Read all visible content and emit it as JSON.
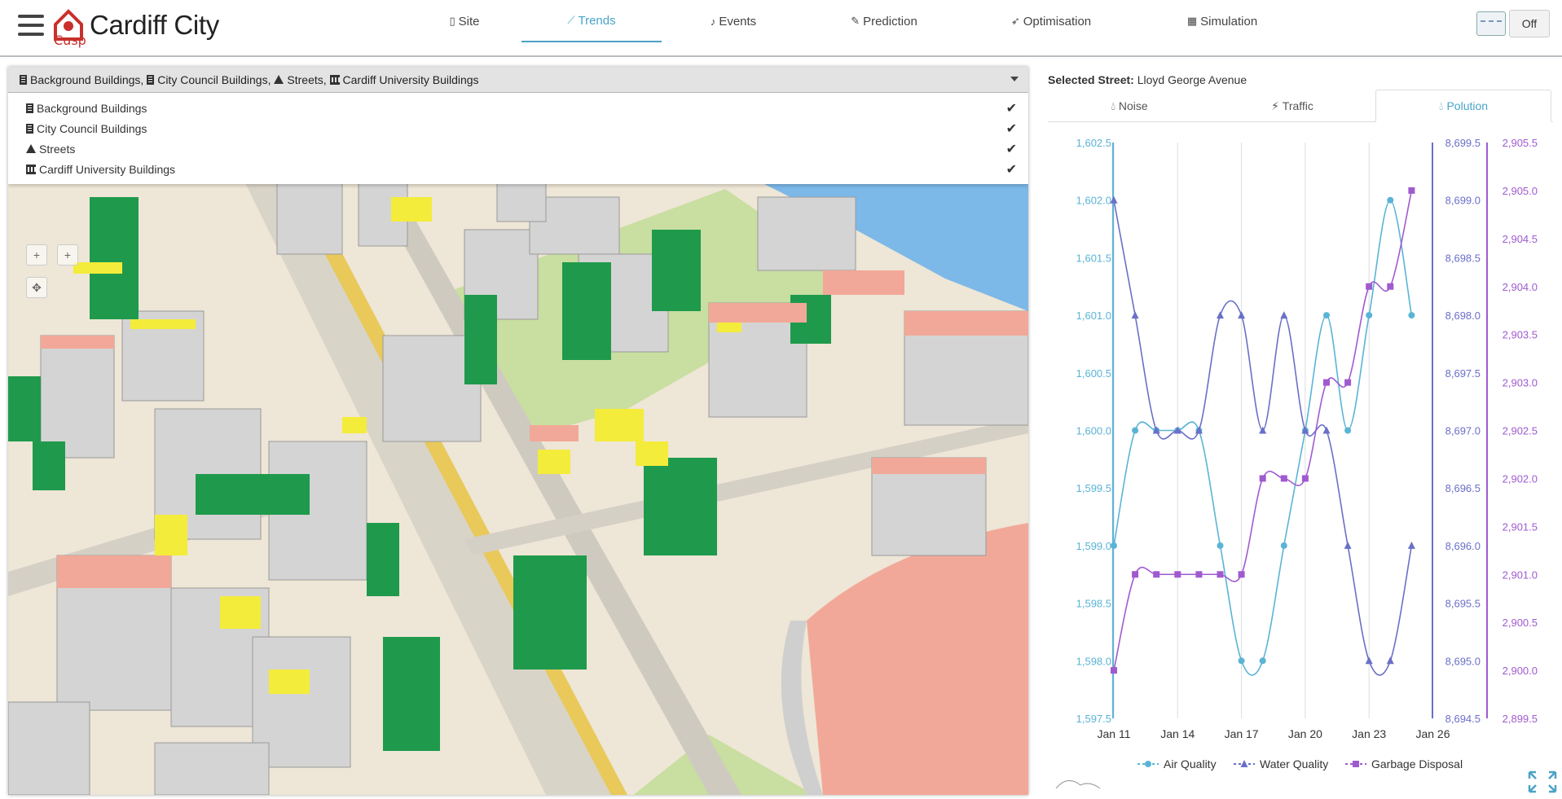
{
  "header": {
    "title": "Cardiff City",
    "logo_text": "Cusp",
    "nav": [
      {
        "label": "Site",
        "icon": "building-icon"
      },
      {
        "label": "Trends",
        "icon": "line-chart-icon",
        "active": true
      },
      {
        "label": "Events",
        "icon": "bell-icon"
      },
      {
        "label": "Prediction",
        "icon": "magic-icon"
      },
      {
        "label": "Optimisation",
        "icon": "rocket-icon"
      },
      {
        "label": "Simulation",
        "icon": "calculator-icon"
      }
    ],
    "toggle_label": "Off"
  },
  "layers": {
    "summary": "Background Buildings, City Council Buildings, Streets, Cardiff University Buildings",
    "summary_parts": [
      "Background Buildings,",
      "City Council Buildings,",
      "Streets,",
      "Cardiff University Buildings"
    ],
    "items": [
      {
        "label": "Background Buildings",
        "checked": true
      },
      {
        "label": "City Council Buildings",
        "checked": true
      },
      {
        "label": "Streets",
        "checked": true
      },
      {
        "label": "Cardiff University Buildings",
        "checked": true
      }
    ]
  },
  "map_controls": [
    "+",
    "+",
    "✥"
  ],
  "panel": {
    "selected_label": "Selected Street:",
    "selected_value": "Lloyd George Avenue",
    "tabs": [
      {
        "label": "Noise",
        "icon": "drop-icon"
      },
      {
        "label": "Traffic",
        "icon": "bolt-icon"
      },
      {
        "label": "Polution",
        "icon": "drop-icon",
        "active": true
      }
    ]
  },
  "chart_data": {
    "type": "line",
    "x": [
      "Jan 11",
      "Jan 12",
      "Jan 13",
      "Jan 14",
      "Jan 15",
      "Jan 16",
      "Jan 17",
      "Jan 18",
      "Jan 19",
      "Jan 20",
      "Jan 21",
      "Jan 22",
      "Jan 23",
      "Jan 24",
      "Jan 25"
    ],
    "xticks": [
      "Jan 11",
      "Jan 14",
      "Jan 17",
      "Jan 20",
      "Jan 23",
      "Jan 26"
    ],
    "series": [
      {
        "name": "Air Quality",
        "color": "#5ab4d6",
        "marker": "circle",
        "values": [
          1599.0,
          1600.0,
          1600.0,
          1600.0,
          1600.0,
          1599.0,
          1598.0,
          1598.0,
          1599.0,
          1600.0,
          1601.0,
          1600.0,
          1601.0,
          1602.0,
          1601.0
        ],
        "axis": {
          "min": 1597.5,
          "max": 1602.5,
          "ticks": [
            "1,597.5",
            "1,598.0",
            "1,598.5",
            "1,599.0",
            "1,599.5",
            "1,600.0",
            "1,600.5",
            "1,601.0",
            "1,601.5",
            "1,602.0",
            "1,602.5"
          ]
        }
      },
      {
        "name": "Water Quality",
        "color": "#6a6fc8",
        "marker": "triangle",
        "values": [
          8699.0,
          8698.0,
          8697.0,
          8697.0,
          8697.0,
          8698.0,
          8698.0,
          8697.0,
          8698.0,
          8697.0,
          8697.0,
          8696.0,
          8695.0,
          8695.0,
          8696.0
        ],
        "axis": {
          "min": 8694.5,
          "max": 8699.5,
          "ticks": [
            "8,694.5",
            "8,695.0",
            "8,695.5",
            "8,696.0",
            "8,696.5",
            "8,697.0",
            "8,697.5",
            "8,698.0",
            "8,698.5",
            "8,699.0",
            "8,699.5"
          ]
        }
      },
      {
        "name": "Garbage Disposal",
        "color": "#a05ad0",
        "marker": "square",
        "values": [
          2900.0,
          2901.0,
          2901.0,
          2901.0,
          2901.0,
          2901.0,
          2901.0,
          2902.0,
          2902.0,
          2902.0,
          2903.0,
          2903.0,
          2904.0,
          2904.0,
          2905.0
        ],
        "axis": {
          "min": 2899.5,
          "max": 2905.5,
          "ticks": [
            "2,899.5",
            "2,900.0",
            "2,900.5",
            "2,901.0",
            "2,901.5",
            "2,902.0",
            "2,902.5",
            "2,903.0",
            "2,903.5",
            "2,904.0",
            "2,904.5",
            "2,905.0",
            "2,905.5"
          ]
        }
      }
    ],
    "grid": "vertical",
    "legend": "bottom"
  }
}
